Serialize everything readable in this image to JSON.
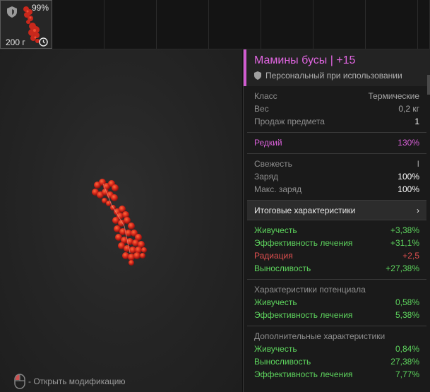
{
  "inventory_slot": {
    "condition_percent": "99%",
    "weight": "200 г"
  },
  "hint": {
    "text": "- Открыть модификацию"
  },
  "item": {
    "title": "Мамины бусы | +15",
    "binding": "Персональный при использовании",
    "accent_color": "#d05bd0"
  },
  "basic": [
    {
      "label": "Класс",
      "value": "Термические"
    },
    {
      "label": "Вес",
      "value": "0,2 кг"
    },
    {
      "label": "Продаж предмета",
      "value": "1"
    }
  ],
  "rarity": {
    "label": "Редкий",
    "value": "130%"
  },
  "state": [
    {
      "label": "Свежесть",
      "value": "I"
    },
    {
      "label": "Заряд",
      "value": "100%"
    },
    {
      "label": "Макс. заряд",
      "value": "100%"
    }
  ],
  "summary": {
    "label": "Итоговые характеристики",
    "chevron": "›"
  },
  "final_stats": [
    {
      "label": "Живучесть",
      "value": "+3,38%"
    },
    {
      "label": "Эффективность лечения",
      "value": "+31,1%"
    },
    {
      "label": "Радиация",
      "value": "+2,5"
    },
    {
      "label": "Выносливость",
      "value": "+27,38%"
    }
  ],
  "potential": {
    "title": "Характеристики потенциала",
    "stats": [
      {
        "label": "Живучесть",
        "value": "0,58%"
      },
      {
        "label": "Эффективность лечения",
        "value": "5,38%"
      }
    ]
  },
  "additional": {
    "title": "Дополнительные характеристики",
    "stats": [
      {
        "label": "Живучесть",
        "value": "0,84%"
      },
      {
        "label": "Выносливость",
        "value": "27,38%"
      },
      {
        "label": "Эффективность лечения",
        "value": "7,77%"
      }
    ]
  },
  "colors": {
    "positive": "#5ed65e",
    "negative": "#e05050",
    "rare": "#d860d8"
  },
  "icons": {
    "slot_shield": "shield-icon",
    "slot_clock": "clock-icon",
    "binding": "shield-icon",
    "mouse": "mouse-icon",
    "summary": "chevron-right-icon"
  }
}
